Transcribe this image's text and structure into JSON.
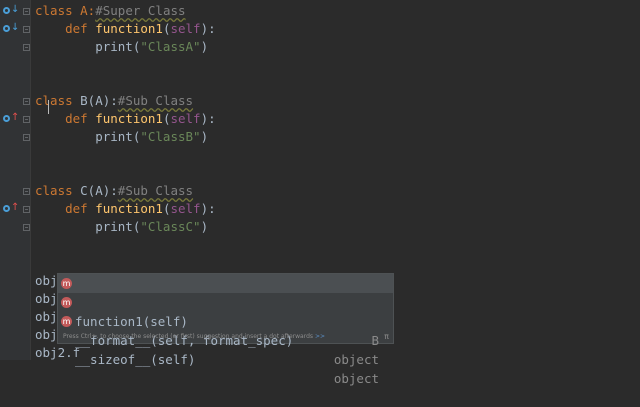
{
  "editor": {
    "lines": [
      {
        "id": "a1",
        "parts": [
          {
            "t": "class A:",
            "c": "kw"
          },
          {
            "t": "#Super Class",
            "c": "cmt wavy"
          }
        ]
      },
      {
        "id": "a2",
        "parts": [
          {
            "t": "    "
          },
          {
            "t": "def ",
            "c": "kw"
          },
          {
            "t": "function1",
            "c": "fn"
          },
          {
            "t": "("
          },
          {
            "t": "self",
            "c": "self"
          },
          {
            "t": "):"
          }
        ]
      },
      {
        "id": "a3",
        "parts": [
          {
            "t": "        print("
          },
          {
            "t": "\"ClassA\"",
            "c": "str"
          },
          {
            "t": ")"
          }
        ]
      },
      {
        "id": "b1",
        "parts": [
          {
            "t": "class ",
            "c": "kw"
          },
          {
            "t": "B(A):"
          },
          {
            "t": "#Sub Class",
            "c": "cmt wavy"
          }
        ]
      },
      {
        "id": "b2",
        "parts": [
          {
            "t": "    "
          },
          {
            "t": "def ",
            "c": "kw"
          },
          {
            "t": "function1",
            "c": "fn"
          },
          {
            "t": "("
          },
          {
            "t": "self",
            "c": "self"
          },
          {
            "t": "):"
          }
        ]
      },
      {
        "id": "b3",
        "parts": [
          {
            "t": "        print("
          },
          {
            "t": "\"ClassB\"",
            "c": "str"
          },
          {
            "t": ")"
          }
        ]
      },
      {
        "id": "c1",
        "parts": [
          {
            "t": "class ",
            "c": "kw"
          },
          {
            "t": "C(A):"
          },
          {
            "t": "#Sub Class",
            "c": "cmt wavy"
          }
        ]
      },
      {
        "id": "c2",
        "parts": [
          {
            "t": "    "
          },
          {
            "t": "def ",
            "c": "kw"
          },
          {
            "t": "function1",
            "c": "fn"
          },
          {
            "t": "("
          },
          {
            "t": "self",
            "c": "self"
          },
          {
            "t": "):"
          }
        ]
      },
      {
        "id": "c3",
        "parts": [
          {
            "t": "        print("
          },
          {
            "t": "\"ClassC\"",
            "c": "str"
          },
          {
            "t": ")"
          }
        ]
      },
      {
        "id": "o1",
        "parts": [
          {
            "t": "obj"
          }
        ]
      },
      {
        "id": "o2",
        "parts": [
          {
            "t": "obj"
          }
        ]
      },
      {
        "id": "o3",
        "parts": [
          {
            "t": "obj"
          }
        ]
      },
      {
        "id": "o4",
        "parts": [
          {
            "t": "obj"
          }
        ]
      },
      {
        "id": "o5",
        "parts": [
          {
            "t": "obj2.f"
          }
        ]
      }
    ]
  },
  "gutter_icons": [
    {
      "name": "overridden-method-icon",
      "arrow": "↓"
    },
    {
      "name": "overridden-method-icon",
      "arrow": "↓"
    },
    {
      "name": "overriding-method-icon",
      "arrow": "↑"
    },
    {
      "name": "overriding-method-icon",
      "arrow": "↑"
    }
  ],
  "completion": {
    "items": [
      {
        "icon": "m",
        "name": "function1(self)",
        "type": "B",
        "selected": true
      },
      {
        "icon": "m",
        "name": "__format__(self, format_spec)",
        "type": "object",
        "selected": false
      },
      {
        "icon": "m",
        "name": "__sizeof__(self)",
        "type": "object",
        "selected": false
      }
    ],
    "hint": "Press Ctrl+. to choose the selected (or first) suggestion and insert a dot afterwards",
    "hint_more": ">>",
    "pi": "π"
  }
}
